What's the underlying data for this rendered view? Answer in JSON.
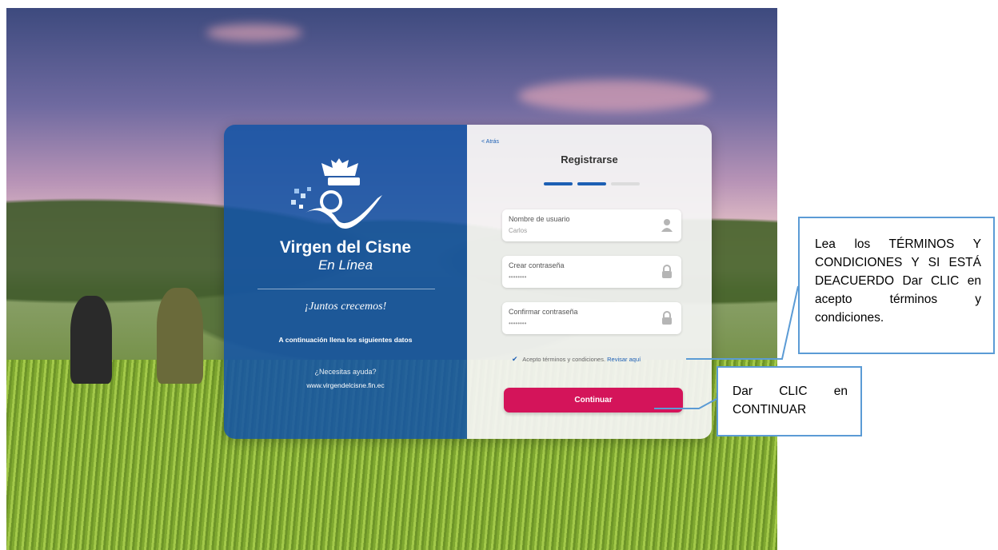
{
  "brand": {
    "name": "Virgen del Cisne",
    "subname": "En Línea",
    "tagline": "¡Juntos crecemos!",
    "instructions": "A continuación llena los siguientes datos",
    "help": "¿Necesitas ayuda?",
    "website": "www.virgendelcisne.fin.ec"
  },
  "form": {
    "back_label": "< Atrás",
    "title": "Registrarse",
    "progress": {
      "steps_total": 3,
      "steps_completed": 2
    },
    "fields": [
      {
        "label": "Nombre de usuario",
        "value": "Carlos",
        "icon": "user-icon"
      },
      {
        "label": "Crear contraseña",
        "value": "••••••••",
        "icon": "lock-icon"
      },
      {
        "label": "Confirmar contraseña",
        "value": "••••••••",
        "icon": "lock-icon"
      }
    ],
    "terms": {
      "checked": true,
      "text": "Acepto términos y condiciones.",
      "link": "Revisar aquí"
    },
    "submit_label": "Continuar"
  },
  "callouts": {
    "terms_note": "Lea los TÉRMINOS Y CONDICIONES Y SI ESTÁ DEACUERDO Dar CLIC en acepto términos y condiciones.",
    "continue_note": "Dar CLIC en CONTINUAR"
  },
  "colors": {
    "panel_blue": "#1554a5",
    "accent_pink": "#d4145a",
    "link_blue": "#1d5fb4",
    "callout_border": "#5b9bd5"
  }
}
